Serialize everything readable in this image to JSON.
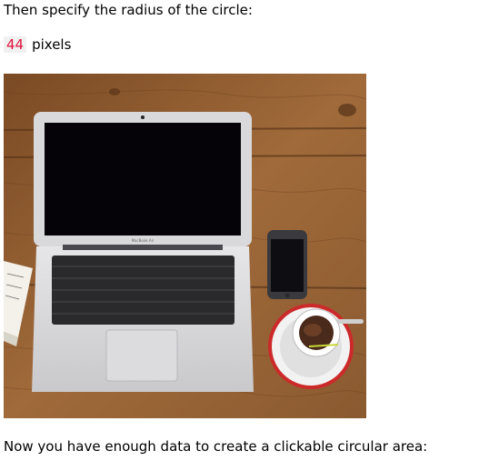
{
  "step_text": "Then specify the radius of the circle:",
  "radius": {
    "value": "44",
    "unit": "pixels"
  },
  "photo_subject": "laptop-phone-coffee-on-wooden-desk",
  "photo_caption_on_laptop": "MacBook Air",
  "result_text": "Now you have enough data to create a clickable circular area:",
  "colors": {
    "code_text": "#dc143c",
    "code_bg": "#f1f1f1"
  }
}
